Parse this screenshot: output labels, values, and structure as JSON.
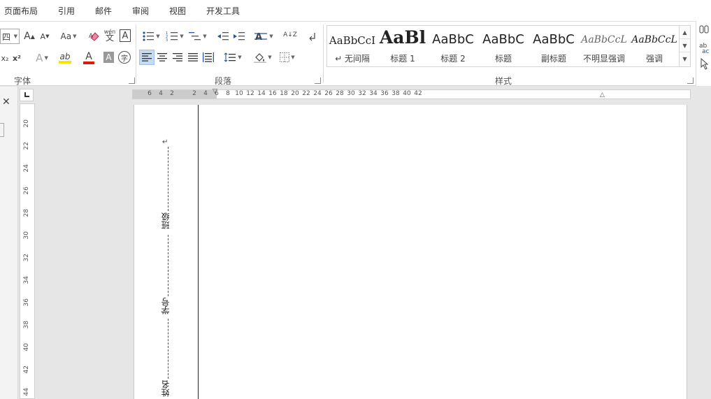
{
  "menu": [
    "页面布局",
    "引用",
    "邮件",
    "审阅",
    "视图",
    "开发工具"
  ],
  "font_group": {
    "size_value": "四",
    "grow": "A",
    "shrink": "A",
    "case": "Aa",
    "phonetic": "wén",
    "phonetic_char": "文",
    "border_char": "A",
    "subscript": "x₂",
    "superscript": "x²",
    "effects": "A",
    "highlight": "ab",
    "font_color": "A",
    "shade": "A",
    "enclose": "字",
    "label": "字体"
  },
  "para_group": {
    "sort": "A↓Z",
    "label": "段落"
  },
  "styles_group": {
    "label": "样式",
    "items": [
      {
        "preview": "AaBbCcI",
        "name": "↵ 无间隔"
      },
      {
        "preview": "AaBl",
        "name": "标题 1"
      },
      {
        "preview": "AaBbC",
        "name": "标题 2"
      },
      {
        "preview": "AaBbC",
        "name": "标题"
      },
      {
        "preview": "AaBbC",
        "name": "副标题"
      },
      {
        "preview": "AaBbCcL",
        "name": "不明显强调"
      },
      {
        "preview": "AaBbCcL",
        "name": "强调"
      }
    ]
  },
  "hruler_ticks": [
    "6",
    "4",
    "2",
    "2",
    "4",
    "6",
    "8",
    "10",
    "12",
    "14",
    "16",
    "18",
    "20",
    "22",
    "24",
    "26",
    "28",
    "30",
    "32",
    "34",
    "36",
    "38",
    "40",
    "42"
  ],
  "vruler_ticks": [
    "20",
    "22",
    "24",
    "26",
    "28",
    "30",
    "32",
    "34",
    "36",
    "38",
    "40",
    "42",
    "44"
  ],
  "document": {
    "mark": "↵",
    "class_label": "班级",
    "id_label": "学号",
    "name_label": "姓名"
  },
  "colors": {
    "highlight": "#f5e50f",
    "font_color": "#d81e06",
    "accent": "#c5dbf2"
  }
}
